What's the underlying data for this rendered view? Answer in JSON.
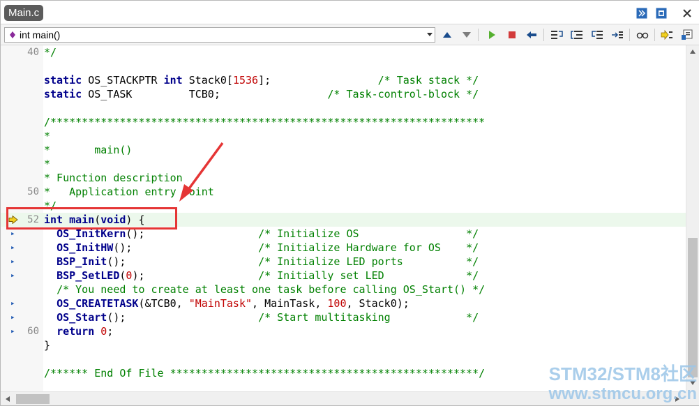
{
  "window": {
    "tab_title": "Main.c",
    "title_icons": [
      "doc-map-icon",
      "float-window-icon",
      "close-icon"
    ]
  },
  "toolbar": {
    "function_selector": "int main()",
    "icons": [
      "scroll-up-icon",
      "scroll-down-icon",
      "run-icon",
      "stop-icon",
      "back-icon",
      "step-into-icon",
      "step-over-icon",
      "step-out-icon",
      "run-to-cursor-icon",
      "watch-icon",
      "set-pc-icon",
      "settings-icon"
    ]
  },
  "editor": {
    "current_line": 52,
    "lines": [
      {
        "num": "40",
        "mark": false,
        "segs": [
          [
            "cm",
            "*/"
          ]
        ]
      },
      {
        "num": "",
        "mark": false,
        "segs": []
      },
      {
        "num": "",
        "mark": false,
        "segs": [
          [
            "kw",
            "static"
          ],
          [
            "pl",
            " OS_STACKPTR "
          ],
          [
            "kw",
            "int"
          ],
          [
            "pl",
            " Stack0["
          ],
          [
            "num",
            "1536"
          ],
          [
            "pl",
            "];                 "
          ],
          [
            "cm",
            "/* Task stack */"
          ]
        ]
      },
      {
        "num": "",
        "mark": false,
        "segs": [
          [
            "kw",
            "static"
          ],
          [
            "pl",
            " OS_TASK         TCB0;                 "
          ],
          [
            "cm",
            "/* Task-control-block */"
          ]
        ]
      },
      {
        "num": "",
        "mark": false,
        "segs": []
      },
      {
        "num": "",
        "mark": false,
        "segs": [
          [
            "cm",
            "/*********************************************************************"
          ]
        ]
      },
      {
        "num": "",
        "mark": false,
        "segs": [
          [
            "cm",
            "*"
          ]
        ]
      },
      {
        "num": "",
        "mark": false,
        "segs": [
          [
            "cm",
            "*       main()"
          ]
        ]
      },
      {
        "num": "",
        "mark": false,
        "segs": [
          [
            "cm",
            "*"
          ]
        ]
      },
      {
        "num": "",
        "mark": false,
        "segs": [
          [
            "cm",
            "* Function description"
          ]
        ]
      },
      {
        "num": "50",
        "mark": false,
        "segs": [
          [
            "cm",
            "*   Application entry point"
          ]
        ]
      },
      {
        "num": "",
        "mark": false,
        "segs": [
          [
            "cm",
            "*/"
          ]
        ]
      },
      {
        "num": "52",
        "mark": false,
        "current": true,
        "segs": [
          [
            "kw",
            "int"
          ],
          [
            "pl",
            " "
          ],
          [
            "fn",
            "main"
          ],
          [
            "pl",
            "("
          ],
          [
            "kw",
            "void"
          ],
          [
            "pl",
            ") {"
          ]
        ]
      },
      {
        "num": "",
        "mark": true,
        "segs": [
          [
            "pl",
            "  "
          ],
          [
            "fn",
            "OS_InitKern"
          ],
          [
            "pl",
            "();                  "
          ],
          [
            "cm",
            "/* Initialize OS                 */"
          ]
        ]
      },
      {
        "num": "",
        "mark": true,
        "segs": [
          [
            "pl",
            "  "
          ],
          [
            "fn",
            "OS_InitHW"
          ],
          [
            "pl",
            "();                    "
          ],
          [
            "cm",
            "/* Initialize Hardware for OS    */"
          ]
        ]
      },
      {
        "num": "",
        "mark": true,
        "segs": [
          [
            "pl",
            "  "
          ],
          [
            "fn",
            "BSP_Init"
          ],
          [
            "pl",
            "();                     "
          ],
          [
            "cm",
            "/* Initialize LED ports          */"
          ]
        ]
      },
      {
        "num": "",
        "mark": true,
        "segs": [
          [
            "pl",
            "  "
          ],
          [
            "fn",
            "BSP_SetLED"
          ],
          [
            "pl",
            "("
          ],
          [
            "num",
            "0"
          ],
          [
            "pl",
            ");                  "
          ],
          [
            "cm",
            "/* Initially set LED             */"
          ]
        ]
      },
      {
        "num": "",
        "mark": false,
        "segs": [
          [
            "pl",
            "  "
          ],
          [
            "cm",
            "/* You need to create at least one task before calling OS_Start() */"
          ]
        ]
      },
      {
        "num": "",
        "mark": true,
        "segs": [
          [
            "pl",
            "  "
          ],
          [
            "fn",
            "OS_CREATETASK"
          ],
          [
            "pl",
            "(&TCB0, "
          ],
          [
            "str",
            "\"MainTask\""
          ],
          [
            "pl",
            ", MainTask, "
          ],
          [
            "num",
            "100"
          ],
          [
            "pl",
            ", Stack0);"
          ]
        ]
      },
      {
        "num": "",
        "mark": true,
        "segs": [
          [
            "pl",
            "  "
          ],
          [
            "fn",
            "OS_Start"
          ],
          [
            "pl",
            "();                     "
          ],
          [
            "cm",
            "/* Start multitasking            */"
          ]
        ]
      },
      {
        "num": "60",
        "mark": true,
        "segs": [
          [
            "pl",
            "  "
          ],
          [
            "kw",
            "return"
          ],
          [
            "pl",
            " "
          ],
          [
            "num",
            "0"
          ],
          [
            "pl",
            ";"
          ]
        ]
      },
      {
        "num": "",
        "mark": false,
        "segs": [
          [
            "pl",
            "}"
          ]
        ]
      },
      {
        "num": "",
        "mark": false,
        "segs": []
      },
      {
        "num": "",
        "mark": false,
        "segs": [
          [
            "cm",
            "/****** End Of File *************************************************/"
          ]
        ]
      }
    ]
  },
  "watermark": {
    "line1": "STM32/STM8社区",
    "line2": "www.stmcu.org.cn"
  },
  "colors": {
    "keyword": "#00008b",
    "comment": "#008000",
    "number": "#c00000",
    "current_line_bg": "#ecf8ec",
    "annotation": "#e53535"
  }
}
